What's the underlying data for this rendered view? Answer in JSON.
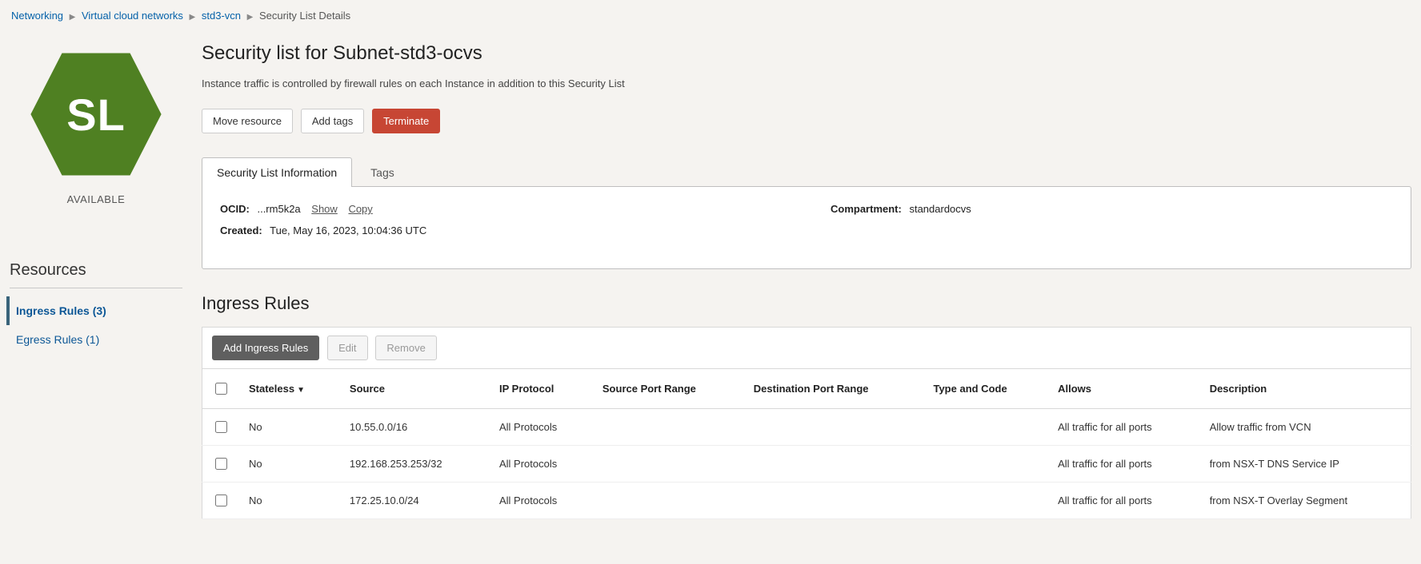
{
  "breadcrumb": {
    "items": [
      {
        "label": "Networking"
      },
      {
        "label": "Virtual cloud networks"
      },
      {
        "label": "std3-vcn"
      }
    ],
    "current": "Security List Details"
  },
  "badge": {
    "letters": "SL",
    "status": "AVAILABLE"
  },
  "header": {
    "title": "Security list for Subnet-std3-ocvs",
    "subtitle": "Instance traffic is controlled by firewall rules on each Instance in addition to this Security List",
    "buttons": {
      "move": "Move resource",
      "tags": "Add tags",
      "terminate": "Terminate"
    }
  },
  "tabs": {
    "info": "Security List Information",
    "tags": "Tags"
  },
  "info": {
    "ocid_label": "OCID:",
    "ocid_value": "...rm5k2a",
    "show": "Show",
    "copy": "Copy",
    "created_label": "Created:",
    "created_value": "Tue, May 16, 2023, 10:04:36 UTC",
    "compartment_label": "Compartment:",
    "compartment_value": "standardocvs"
  },
  "sidebar": {
    "heading": "Resources",
    "items": [
      {
        "label": "Ingress Rules (3)"
      },
      {
        "label": "Egress Rules (1)"
      }
    ]
  },
  "rules": {
    "heading": "Ingress Rules",
    "toolbar": {
      "add": "Add Ingress Rules",
      "edit": "Edit",
      "remove": "Remove"
    },
    "columns": {
      "stateless": "Stateless",
      "source": "Source",
      "protocol": "IP Protocol",
      "src_port": "Source Port Range",
      "dst_port": "Destination Port Range",
      "type_code": "Type and Code",
      "allows": "Allows",
      "desc": "Description"
    },
    "rows": [
      {
        "stateless": "No",
        "source": "10.55.0.0/16",
        "protocol": "All Protocols",
        "src_port": "",
        "dst_port": "",
        "type_code": "",
        "allows": "All traffic for all ports",
        "desc": "Allow traffic from VCN"
      },
      {
        "stateless": "No",
        "source": "192.168.253.253/32",
        "protocol": "All Protocols",
        "src_port": "",
        "dst_port": "",
        "type_code": "",
        "allows": "All traffic for all ports",
        "desc": "from NSX-T DNS Service IP"
      },
      {
        "stateless": "No",
        "source": "172.25.10.0/24",
        "protocol": "All Protocols",
        "src_port": "",
        "dst_port": "",
        "type_code": "",
        "allows": "All traffic for all ports",
        "desc": "from NSX-T Overlay Segment"
      }
    ]
  }
}
